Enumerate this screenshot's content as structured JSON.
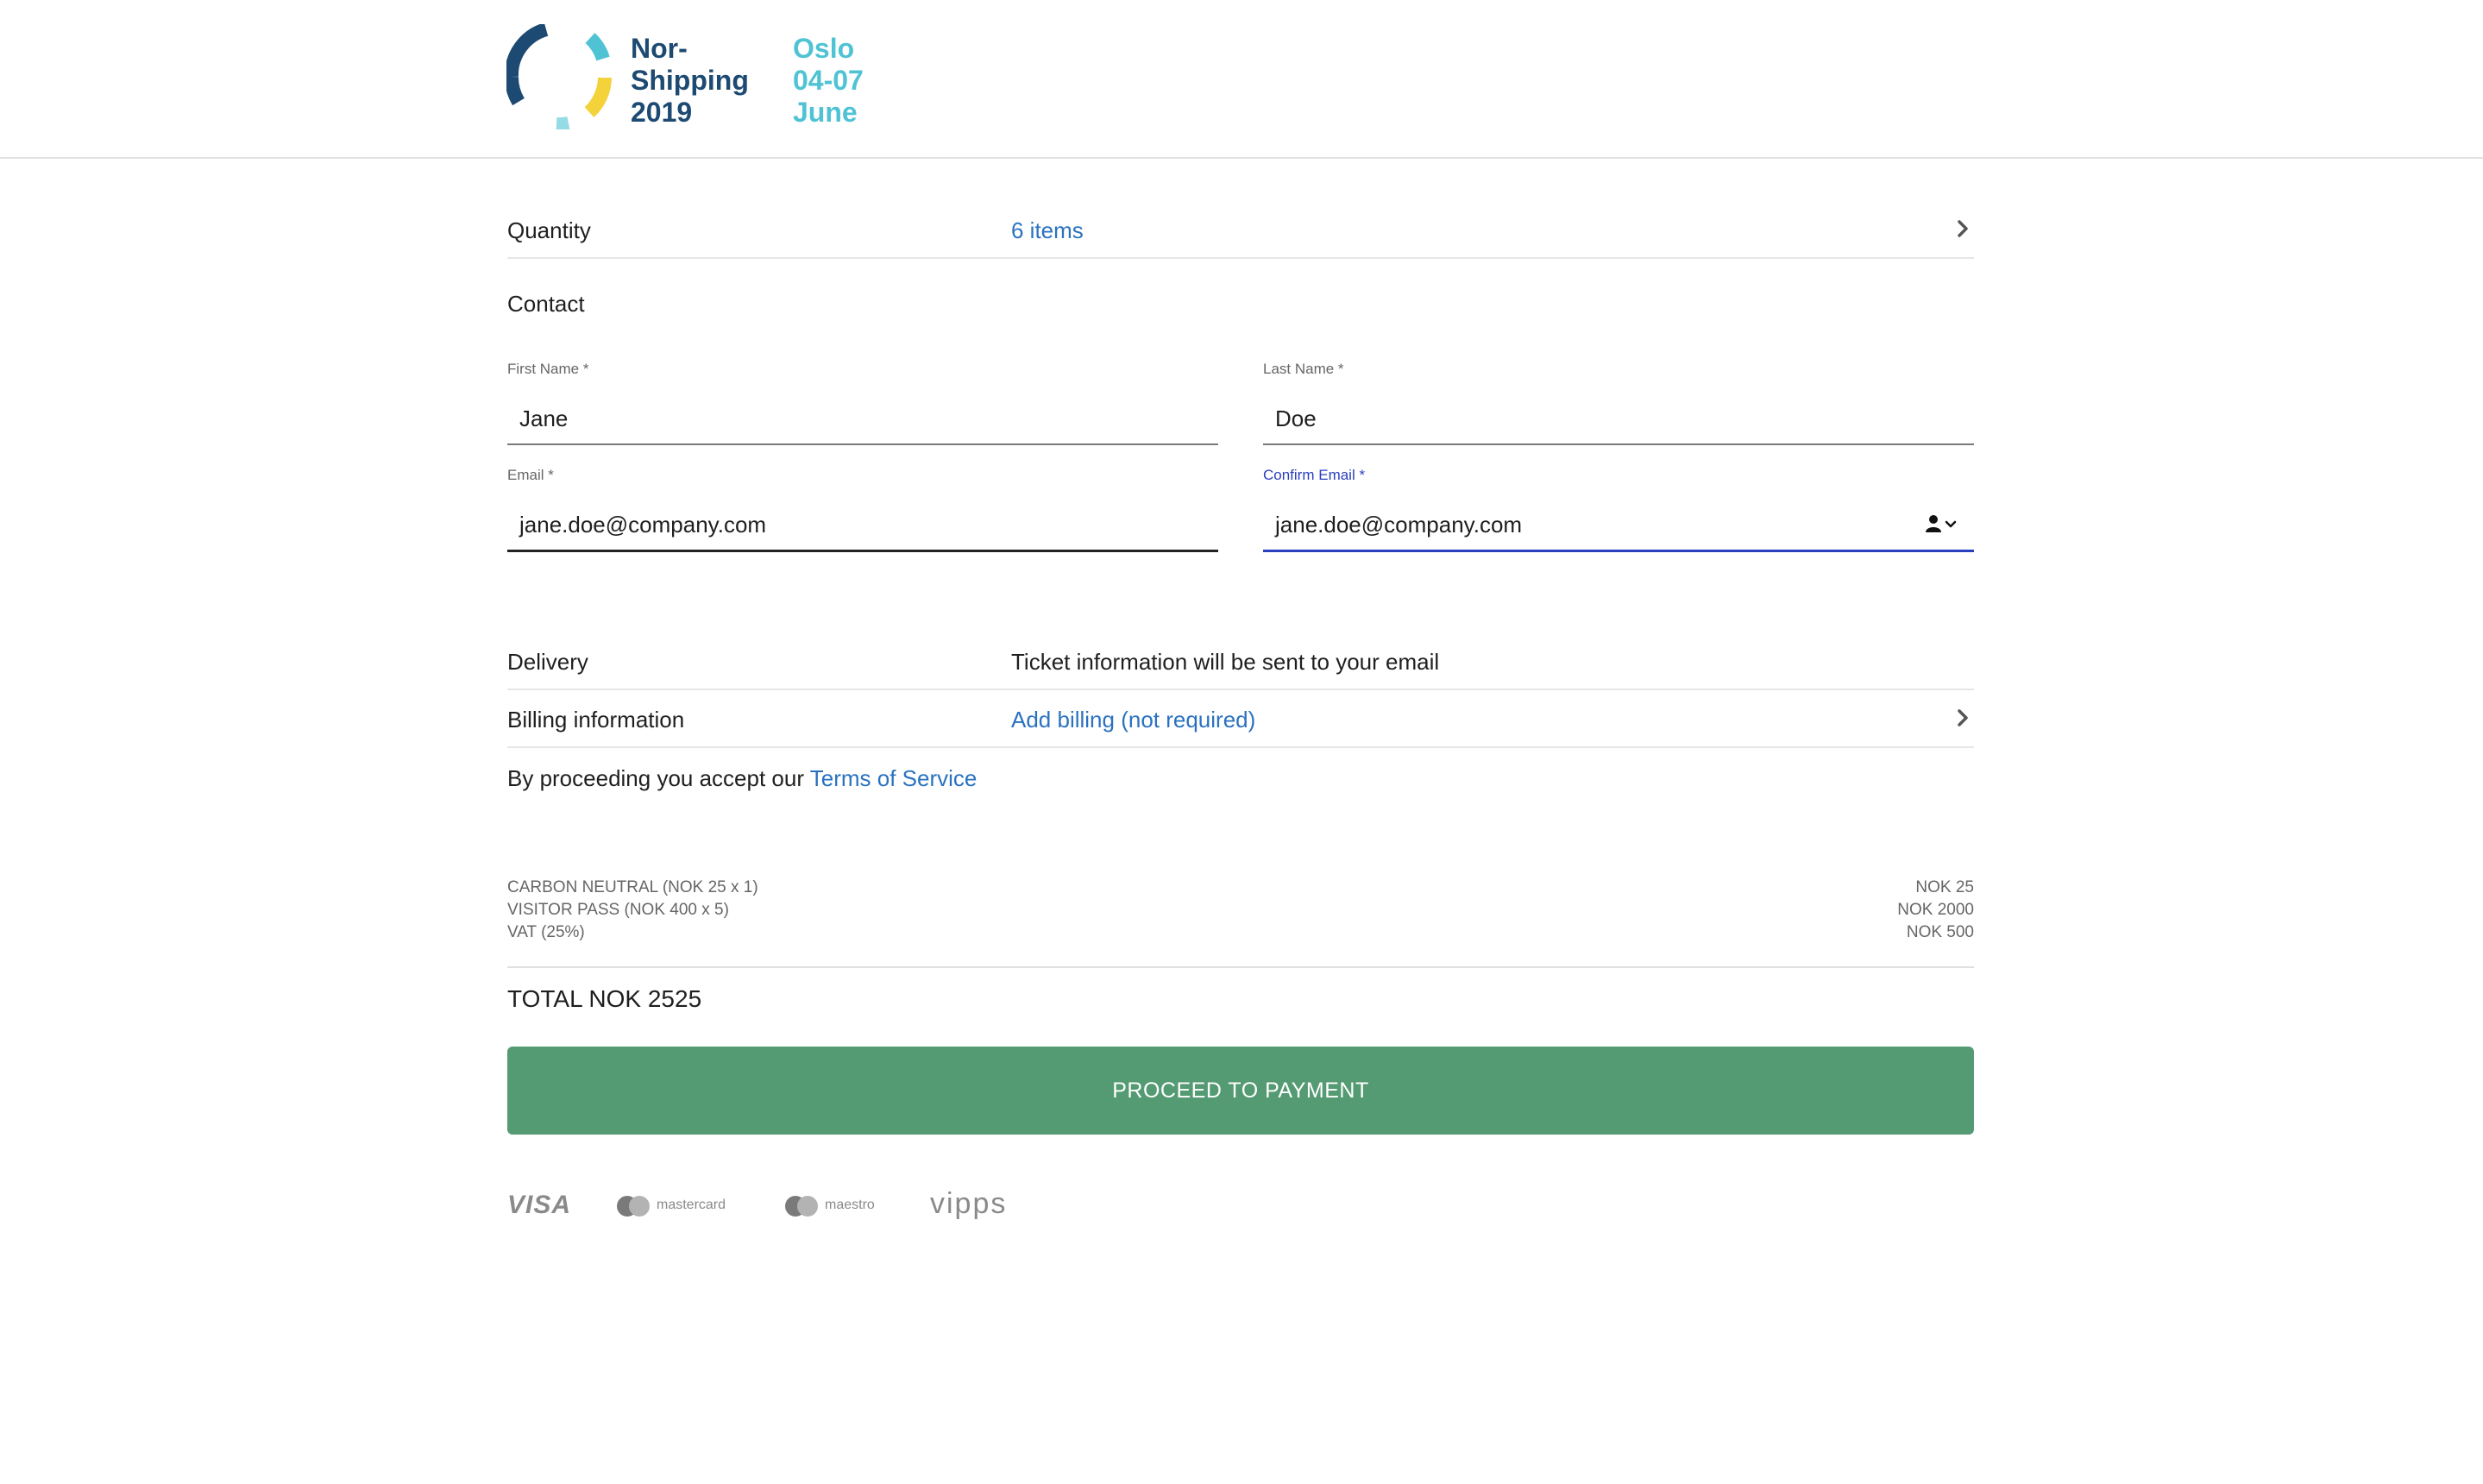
{
  "logo": {
    "name_lines": [
      "Nor-",
      "Shipping",
      "2019"
    ],
    "place_lines": [
      "Oslo",
      "04-07",
      "June"
    ],
    "colors": {
      "dark_blue": "#1d4a72",
      "teal": "#4fc3d4",
      "yellow": "#f3d23a"
    }
  },
  "quantity": {
    "label": "Quantity",
    "value": "6 items",
    "icon": "chevron-right-icon"
  },
  "contact": {
    "title": "Contact",
    "first_name": {
      "label": "First Name *",
      "value": "Jane"
    },
    "last_name": {
      "label": "Last Name *",
      "value": "Doe"
    },
    "email": {
      "label": "Email *",
      "value": "jane.doe@company.com"
    },
    "confirm_email": {
      "label": "Confirm Email *",
      "value": "jane.doe@company.com",
      "icon": "contact-autofill-icon"
    }
  },
  "delivery": {
    "label": "Delivery",
    "value": "Ticket information will be sent to your email"
  },
  "billing": {
    "label": "Billing information",
    "value": "Add billing (not required)",
    "icon": "chevron-right-icon"
  },
  "terms": {
    "prefix": "By proceeding you accept our",
    "link": "Terms of Service"
  },
  "summary": {
    "items": [
      {
        "label": "CARBON NEUTRAL (NOK 25 x 1)",
        "amount": "NOK 25"
      },
      {
        "label": "VISITOR PASS (NOK 400 x 5)",
        "amount": "NOK 2000"
      },
      {
        "label": "VAT (25%)",
        "amount": "NOK 500"
      }
    ],
    "total": "TOTAL NOK 2525"
  },
  "payment_button": {
    "label": "PROCEED TO PAYMENT",
    "color": "#549a72"
  },
  "payment_methods": {
    "visa": "VISA",
    "mastercard": "mastercard",
    "maestro": "maestro",
    "vipps": "vipps"
  },
  "accent_colors": {
    "link": "#2a72c0",
    "focus": "#2a3fbf"
  }
}
